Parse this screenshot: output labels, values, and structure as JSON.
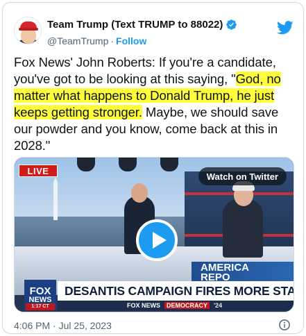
{
  "author": {
    "display_name": "Team Trump (Text TRUMP to 88022)",
    "handle": "@TeamTrump",
    "separator": "·",
    "follow_label": "Follow"
  },
  "icons": {
    "verified": "verified-badge-icon",
    "twitter": "twitter-bird-icon",
    "info": "info-icon",
    "play": "play-icon"
  },
  "colors": {
    "twitter_blue": "#1d9bf0",
    "highlight": "#fffe3d",
    "text_primary": "#0f1419",
    "text_secondary": "#536471"
  },
  "tweet": {
    "text_before": "Fox News' John Roberts: If you're a candidate, you've got to be looking at this saying, \"",
    "text_highlighted": "God, no matter what happens to Donald Trump, he just keeps getting stronger.",
    "text_after": " Maybe, we should save our powder and you know, come back at this in 2028.\""
  },
  "media": {
    "live_label": "LIVE",
    "watch_label": "Watch on Twitter",
    "desk_text_line1": "AMERICA",
    "desk_text_line2": "REPO",
    "logo_top": "FOX",
    "logo_bottom": "NEWS",
    "time_label": "1:17 CT",
    "headline": "DESANTIS CAMPAIGN FIRES MORE STAFF IN REBOOT",
    "ticker_brand": "FOX NEWS",
    "ticker_tag": "DEMOCRACY",
    "ticker_year": "'24"
  },
  "footer": {
    "timestamp": "4:06 PM · Jul 25, 2023"
  }
}
